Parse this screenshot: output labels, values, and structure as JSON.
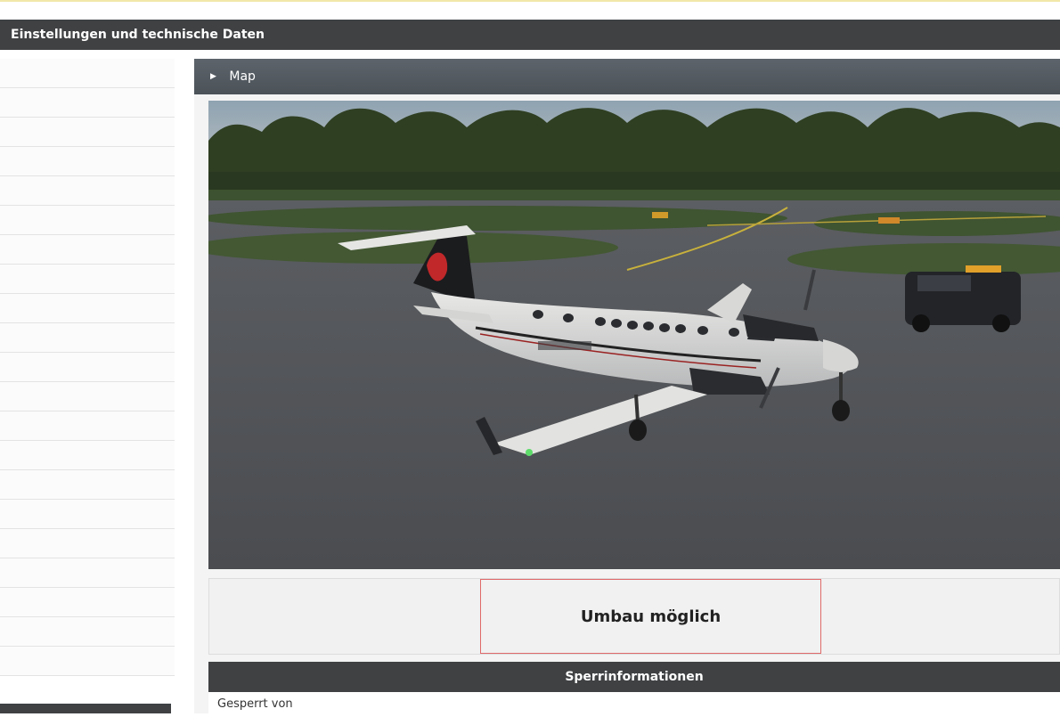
{
  "header": {
    "title": "Einstellungen und technische Daten"
  },
  "map_panel": {
    "title": "Map",
    "image_alt_icon": "aircraft-scene"
  },
  "status": {
    "umbau_label": "Umbau möglich"
  },
  "lock_info": {
    "title": "Sperrinformationen",
    "locked_by_label": "Gesperrt von"
  },
  "colors": {
    "header_bg": "#3f4143",
    "map_header_bg": "#5d646b",
    "highlight_border": "#e06a6a"
  }
}
